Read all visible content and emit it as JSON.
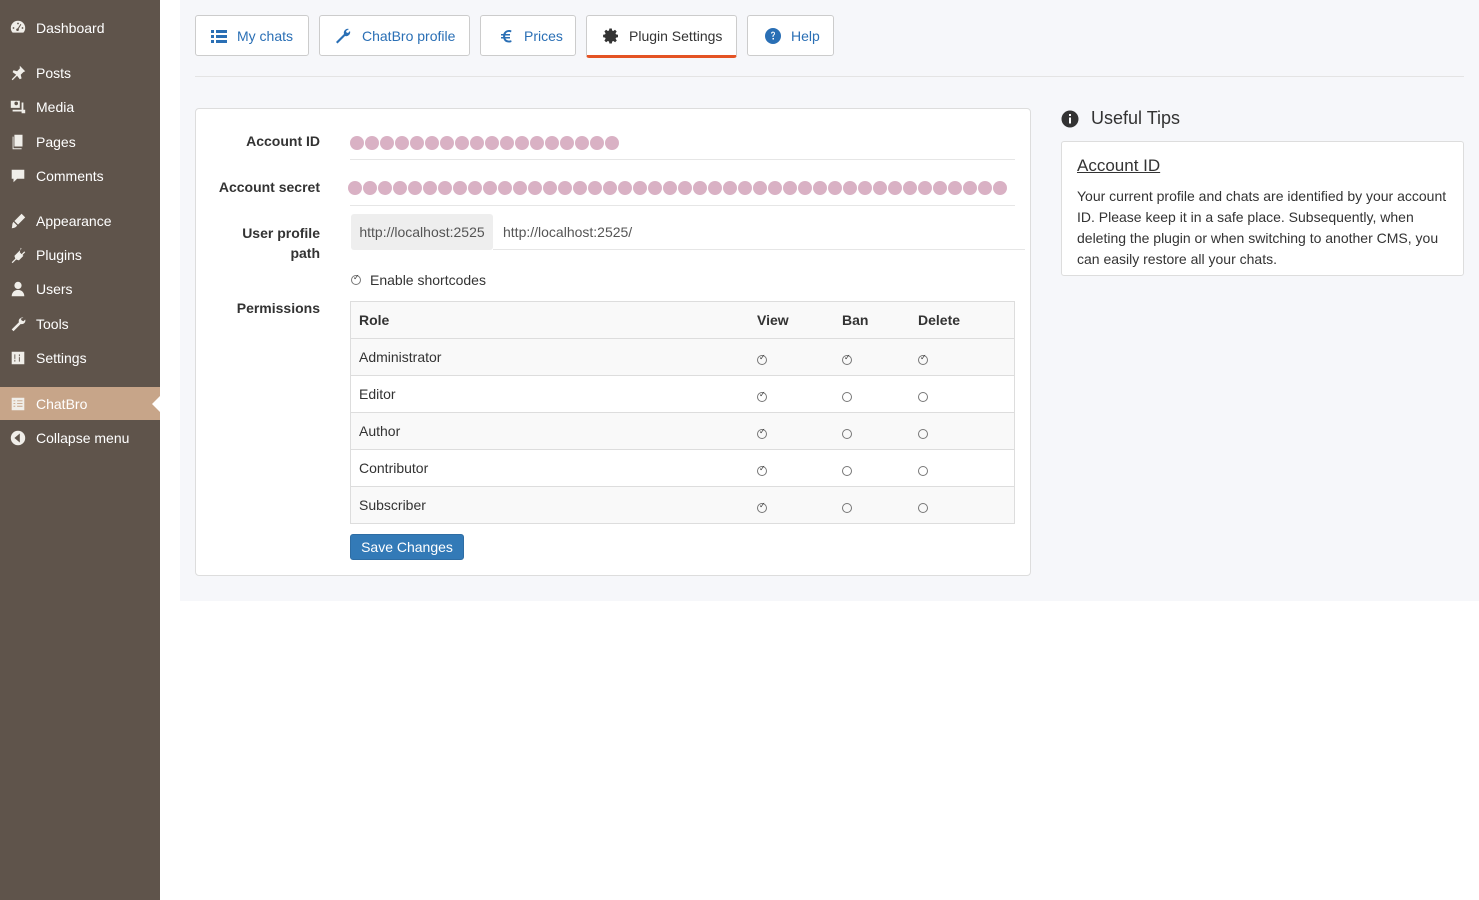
{
  "sidebar": {
    "items": [
      {
        "label": "Dashboard",
        "icon": "dashboard-icon"
      },
      {
        "label": "Posts",
        "icon": "pin-icon"
      },
      {
        "label": "Media",
        "icon": "media-icon"
      },
      {
        "label": "Pages",
        "icon": "pages-icon"
      },
      {
        "label": "Comments",
        "icon": "comment-icon"
      },
      {
        "label": "Appearance",
        "icon": "brush-icon"
      },
      {
        "label": "Plugins",
        "icon": "plug-icon"
      },
      {
        "label": "Users",
        "icon": "user-icon"
      },
      {
        "label": "Tools",
        "icon": "wrench-icon"
      },
      {
        "label": "Settings",
        "icon": "sliders-icon"
      },
      {
        "label": "ChatBro",
        "icon": "chatbro-icon",
        "active": true
      },
      {
        "label": "Collapse menu",
        "icon": "collapse-icon"
      }
    ]
  },
  "tabs": [
    {
      "label": "My chats",
      "icon": "list-icon"
    },
    {
      "label": "ChatBro profile",
      "icon": "wrench-icon"
    },
    {
      "label": "Prices",
      "icon": "euro-icon"
    },
    {
      "label": "Plugin Settings",
      "icon": "gear-icon",
      "active": true
    },
    {
      "label": "Help",
      "icon": "question-icon"
    }
  ],
  "form": {
    "account_id_label": "Account ID",
    "account_secret_label": "Account secret",
    "user_profile_path_label_1": "User profile",
    "user_profile_path_label_2": "path",
    "user_profile_path_prefix": "http://localhost:2525",
    "user_profile_path_value": "http://localhost:2525/",
    "enable_shortcodes_label": "Enable shortcodes",
    "enable_shortcodes_checked": true,
    "permissions_label": "Permissions",
    "save_label": "Save Changes"
  },
  "permissions": {
    "headers": [
      "Role",
      "View",
      "Ban",
      "Delete"
    ],
    "rows": [
      {
        "role": "Administrator",
        "view": true,
        "ban": true,
        "delete": true
      },
      {
        "role": "Editor",
        "view": true,
        "ban": false,
        "delete": false
      },
      {
        "role": "Author",
        "view": true,
        "ban": false,
        "delete": false
      },
      {
        "role": "Contributor",
        "view": true,
        "ban": false,
        "delete": false
      },
      {
        "role": "Subscriber",
        "view": true,
        "ban": false,
        "delete": false
      }
    ]
  },
  "tips": {
    "title": "Useful Tips",
    "heading": "Account ID",
    "text": "Your current profile and chats are identified by your account ID. Please keep it in a safe place. Subsequently, when deleting the plugin or when switching to another CMS, you can easily restore all your chats."
  },
  "colors": {
    "sidebar_bg": "#5f544b",
    "sidebar_active": "#c7a589",
    "link": "#2a6fb5",
    "active_tab_underline": "#e45324",
    "primary_button": "#337ab7",
    "masked_value": "#d9b1c4"
  }
}
